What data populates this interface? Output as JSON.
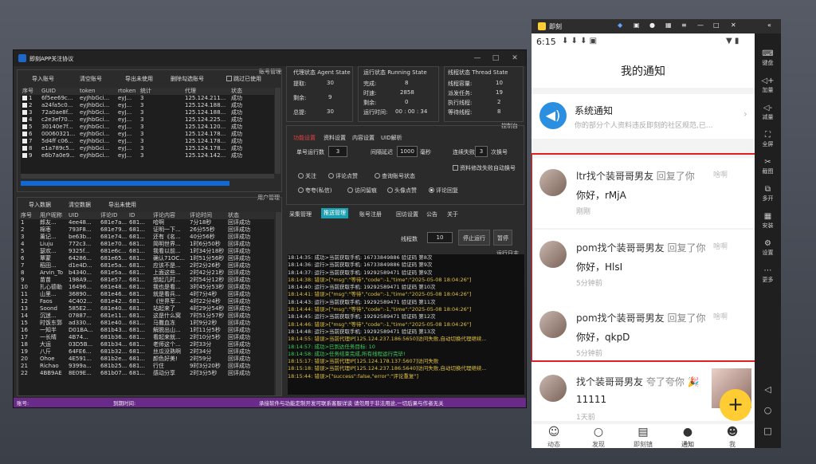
{
  "app": {
    "title": "即刻APP关注协议",
    "account_mgmt": "账号管理",
    "user_mgmt": "用户管理",
    "control_panel": "控制台",
    "run_log": "运行日志",
    "buttons_top": [
      "导入账号",
      "清空账号",
      "导出未使用",
      "删除勾选账号"
    ],
    "skip_used": "跳过已使用",
    "acct_cols": [
      "序号",
      "GUID",
      "token",
      "rtoken",
      "统计",
      "代理",
      "状态"
    ],
    "acct_rows": [
      [
        "1",
        "6f5ee69c...",
        "eyJhbGci...",
        "eyJ...",
        "3",
        "125.124.211...",
        "成功"
      ],
      [
        "2",
        "a24fa5c0...",
        "eyJhbGci...",
        "eyJ...",
        "3",
        "125.124.188...",
        "成功"
      ],
      [
        "3",
        "72a0ae8f...",
        "eyJhbGci...",
        "eyJ...",
        "3",
        "125.124.188...",
        "成功"
      ],
      [
        "4",
        "c2e3ef70...",
        "eyJhbGci...",
        "eyJ...",
        "3",
        "125.124.225...",
        "成功"
      ],
      [
        "5",
        "30140e7f...",
        "eyJhbGci...",
        "eyJ...",
        "3",
        "125.124.120...",
        "成功"
      ],
      [
        "6",
        "00060321...",
        "eyJhbGci...",
        "eyJ...",
        "3",
        "125.124.178...",
        "成功"
      ],
      [
        "7",
        "5d4ff c06...",
        "eyJhbGci...",
        "eyJ...",
        "3",
        "125.124.178...",
        "成功"
      ],
      [
        "8",
        "e1a789c5...",
        "eyJhbGci...",
        "eyJ...",
        "3",
        "125.124.178...",
        "成功"
      ],
      [
        "9",
        "e6b7a0e9...",
        "eyJhbGci...",
        "eyJ...",
        "3",
        "125.124.142...",
        "成功"
      ]
    ],
    "agent_state": {
      "title": "代理状态 Agent State",
      "fetch_label": "提取:",
      "fetch": "30",
      "remain_label": "剩余:",
      "remain": "9",
      "total_label": "总提:",
      "total": "30"
    },
    "running_state": {
      "title": "运行状态 Running State",
      "done_label": "完成:",
      "done": "8",
      "time_label": "时速:",
      "time": "2858",
      "remain_label": "剩余:",
      "remain": "0",
      "runtime_label": "运行时间:",
      "runtime": "00 : 00 : 34"
    },
    "thread_state": {
      "title": "线程状态 Thread State",
      "cap_label": "线程容量:",
      "cap": "10",
      "dispatch_label": "派发任务:",
      "dispatch": "19",
      "exec_label": "执行线程:",
      "exec": "2",
      "wait_label": "等待线程:",
      "wait": "8"
    },
    "func_tabs": [
      "功能设置",
      "资料设置",
      "内容设置",
      "UID解析"
    ],
    "single_run_label": "单号运行数",
    "single_run": "3",
    "interval_label": "间隔延迟",
    "interval": "1000",
    "ms": "毫秒",
    "consec_fail_label": "连续失败",
    "consec_fail": "3",
    "switch": "次换号",
    "auto_switch": "资料修改失败自动换号",
    "radios": [
      "关注",
      "评论点赞",
      "查询账号状态",
      "夸夸(私信)",
      "访问留痕",
      "头像点赞",
      "评论回复"
    ],
    "sub_tabs": [
      "采集管理",
      "推送管理",
      "账号注册",
      "回访设置",
      "公告",
      "关于"
    ],
    "threads_label": "线程数",
    "threads": "10",
    "stop_btn": "停止运行",
    "pause_btn": "暂停",
    "user_buttons": [
      "导入数据",
      "清空数据",
      "导出未使用"
    ],
    "user_cols": [
      "序号",
      "用户昵称",
      "UID",
      "评论ID",
      "ID",
      "评论内容",
      "评论时间",
      "状态"
    ],
    "user_rows": [
      [
        "1",
        "郎友...",
        "4ee48...",
        "681e7a...",
        "681...",
        "哈啊",
        "7分18秒",
        "回评成功"
      ],
      [
        "2",
        "棉枣",
        "793F8...",
        "681e79...",
        "681...",
        "证明一下...",
        "26分55秒",
        "回评成功"
      ],
      [
        "3",
        "薰记...",
        "be63b...",
        "681e74...",
        "681...",
        "还有《名...",
        "40分56秒",
        "回评成功"
      ],
      [
        "4",
        "Liuju",
        "772c3...",
        "681e70...",
        "681...",
        "简明世界...",
        "1时6分50秒",
        "回评成功"
      ],
      [
        "5",
        "瑟欢...",
        "9325f...",
        "681e6c...",
        "681...",
        "我看以前...",
        "1时34分18秒",
        "回评成功"
      ],
      [
        "6",
        "覃蒙",
        "64286...",
        "681e65...",
        "681...",
        "确认71OC...",
        "1时51分56秒",
        "回评成功"
      ],
      [
        "7",
        "稻田...",
        "d1e4D...",
        "681e5a...",
        "681...",
        "应该不是...",
        "2时2分26秒",
        "回评成功"
      ],
      [
        "8",
        "Arvin_To",
        "b4340...",
        "681e5a...",
        "681...",
        "上面这些...",
        "2时42分21秒",
        "回评成功"
      ],
      [
        "9",
        "苗苗",
        "198A9...",
        "681e57...",
        "681...",
        "想起几时...",
        "2时54分12秒",
        "回评成功"
      ],
      [
        "10",
        "扎心德勒",
        "16496...",
        "681e48...",
        "681...",
        "我也是看...",
        "3时45分53秒",
        "回评成功"
      ],
      [
        "11",
        "山里...",
        "36890...",
        "681e46...",
        "681...",
        "就是看兵...",
        "4时7分4秒",
        "回评成功"
      ],
      [
        "12",
        "Faos",
        "4C402...",
        "681e42...",
        "681...",
        "《世界军...",
        "4时22分4秒",
        "回评成功"
      ],
      [
        "13",
        "Soond",
        "585E2...",
        "681e40...",
        "681...",
        "站起来了",
        "4时29分54秒",
        "回评成功"
      ],
      [
        "14",
        "沉迷...",
        "07887...",
        "681e11...",
        "681...",
        "这是什么窝",
        "7时51分57秒",
        "回评成功"
      ],
      [
        "15",
        "时饭东郭",
        "ad330...",
        "681e40...",
        "681...",
        "马撒血冻",
        "1时9分2秒",
        "回评成功"
      ],
      [
        "16",
        "一知半",
        "D01BA...",
        "681b43...",
        "681...",
        "解脱出山...",
        "1时11分5秒",
        "回评成功"
      ],
      [
        "17",
        "一长睛",
        "4B74...",
        "681b36...",
        "681...",
        "看起来就...",
        "2时10分5秒",
        "回评成功"
      ],
      [
        "18",
        "大运",
        "03D5B...",
        "681b34...",
        "681...",
        "老师这个...",
        "2时33分",
        "回评成功"
      ],
      [
        "19",
        "八斤",
        "64FE6...",
        "681b32...",
        "681...",
        "丝瓜没熟啊",
        "2时34分",
        "回评成功"
      ],
      [
        "20",
        "Ohoe",
        "4E591...",
        "681b2e...",
        "681...",
        "颜色好美!",
        "2时59分",
        "回评成功"
      ],
      [
        "21",
        "Richao",
        "9399a...",
        "681b25...",
        "681...",
        "行住",
        "9时3分20秒",
        "回评成功"
      ],
      [
        "22",
        "4BB9AE",
        "8E09E...",
        "681b07...",
        "681...",
        "感动分享",
        "2时3分5秒",
        "回评成功"
      ]
    ],
    "logs": [
      {
        "t": "18:14:35: 成功>当前获取手机: 16733849886   验证码  第8次",
        "c": "#ddd"
      },
      {
        "t": "18:14:36: 运行>当前获取手机: 16733849886   验证码  第9次",
        "c": "#ddd"
      },
      {
        "t": "18:14:37: 运行>当前获取手机: 19292589471   验证码  第9次",
        "c": "#ddd"
      },
      {
        "t": "18:14:38: 错误>[\"msg\":\"等待\",\"code\":-1,\"time\":\"2025-05-08 18:04:26\"]",
        "c": "#e0c040"
      },
      {
        "t": "18:14:40: 运行>当前获取手机: 19292589471   验证码  第10次",
        "c": "#ddd"
      },
      {
        "t": "18:14:41: 错误>[\"msg\":\"等待\",\"code\":-1,\"time\":\"2025-05-08 18:04:26\"]",
        "c": "#e0c040"
      },
      {
        "t": "18:14:43: 运行>当前获取手机: 19292589471   验证码  第11次",
        "c": "#ddd"
      },
      {
        "t": "18:14:44: 错误>[\"msg\":\"等待\",\"code\":-1,\"time\":\"2025-05-08 18:04:26\"]",
        "c": "#e0c040"
      },
      {
        "t": "18:14:45: 运行>当前获取手机: 19292589471   验证码  第12次",
        "c": "#ddd"
      },
      {
        "t": "18:14:46: 错误>[\"msg\":\"等待\",\"code\":-1,\"time\":\"2025-05-08 18:04:26\"]",
        "c": "#e0c040"
      },
      {
        "t": "18:14:48: 运行>当前获取手机: 19292589471   验证码  第13次",
        "c": "#ddd"
      },
      {
        "t": "18:14:55: 错误>当前代理IP[125.124.237.186:5650]访问失败,自动切换代理继续...",
        "c": "#e0c040"
      },
      {
        "t": "18:14:57: 成功>已到达任务目标: 10",
        "c": "#40d060"
      },
      {
        "t": "18:14:58: 成功>任务结束完成,所有线程运行完毕!",
        "c": "#40d060"
      },
      {
        "t": "18:15:17: 错误>当前代理IP[125.124.178.137:5607]访问失败",
        "c": "#e0c040"
      },
      {
        "t": "18:15:18: 错误>当前代理IP[125.124.237.186:5640]访问失败,自动切换代理继续...",
        "c": "#e0c040"
      },
      {
        "t": "18:15:44: 错误>[\"success\":false,\"error\":\"评论重复\"]",
        "c": "#e0c040"
      }
    ],
    "status_bar": {
      "account": "账号:",
      "expire": "到期时间:",
      "notice": "承接软件与功能定制开发可联系客服详谈    请勿用于非法用途,一切后果与作者无关"
    }
  },
  "phone": {
    "tab_title": "即刻",
    "time": "6:15",
    "page_title": "我的通知",
    "sys_title": "系统通知",
    "sys_desc": "你的部分个人资料违反即刻的社区规范,已...",
    "messages": [
      {
        "name": "ltr找个装哥哥男友",
        "action": " 回复了你",
        "text": "你好，rMjA",
        "time": "刚刚",
        "right": "啥啊"
      },
      {
        "name": "pom找个装哥哥男友",
        "action": " 回复了你",
        "text": "你好，HlsI",
        "time": "5分钟前",
        "right": "啥啊"
      },
      {
        "name": "pom找个装哥哥男友",
        "action": " 回复了你",
        "text": "你好，qkpD",
        "time": "5分钟前",
        "right": "啥啊"
      },
      {
        "name": "找个装哥哥男友",
        "action": " 夸了夸你 🎉",
        "text": "11111",
        "time": "1天前",
        "right": ""
      }
    ],
    "tabs": [
      "动态",
      "发现",
      "即刻镇",
      "通知",
      "我"
    ],
    "side": [
      "键盘",
      "加量",
      "减量",
      "全屏",
      "截图",
      "多开",
      "安装",
      "设置",
      "更多"
    ],
    "colors": {
      "accent": "#ffcc33",
      "highlight": "#e02020",
      "sys_icon": "#2a8fe0"
    }
  }
}
